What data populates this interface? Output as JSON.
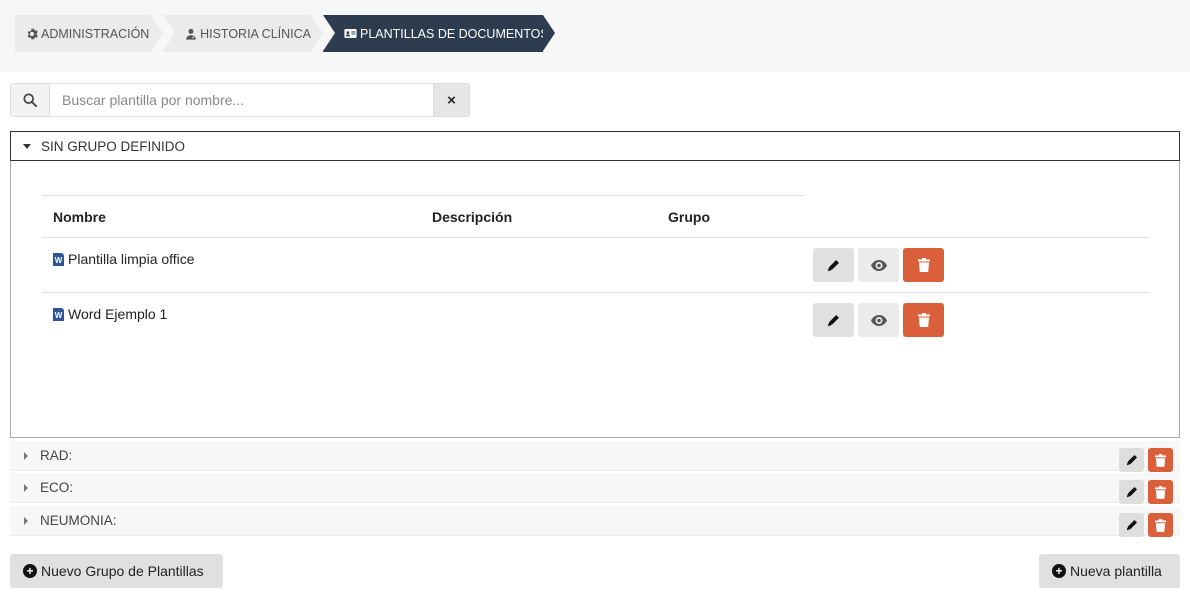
{
  "breadcrumb": {
    "items": [
      {
        "label": "ADMINISTRACIÓN",
        "icon": "gear-icon"
      },
      {
        "label": "HISTORIA CLÍNICA",
        "icon": "user-doctor-icon"
      },
      {
        "label": "PLANTILLAS DE DOCUMENTOS",
        "icon": "id-card-icon"
      }
    ]
  },
  "search": {
    "placeholder": "Buscar plantilla por nombre...",
    "value": "",
    "clear_label": "×"
  },
  "panel": {
    "title": "SIN GRUPO DEFINIDO",
    "columns": [
      "Nombre",
      "Descripción",
      "Grupo"
    ],
    "rows": [
      {
        "name": "Plantilla limpia office",
        "description": "",
        "group": "",
        "icon": "word-file-icon"
      },
      {
        "name": "Word Ejemplo 1",
        "description": "",
        "group": "",
        "icon": "word-file-icon"
      }
    ]
  },
  "groups": [
    {
      "label": "RAD:"
    },
    {
      "label": "ECO:"
    },
    {
      "label": "NEUMONIA:"
    }
  ],
  "footer": {
    "new_group_label": "Nuevo Grupo de Plantillas",
    "new_template_label": "Nueva plantilla"
  },
  "colors": {
    "breadcrumb_active": "#2e3c50",
    "danger": "#d9603b",
    "button_gray": "#e0e0e0"
  }
}
